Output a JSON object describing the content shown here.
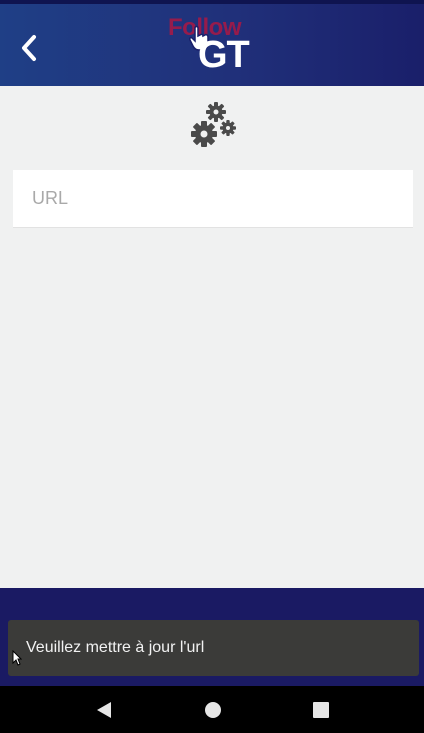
{
  "header": {
    "logo_top_text": "Follow",
    "logo_bottom_text": "GT",
    "icons": {
      "back": "chevron-left-icon",
      "logo_pointer": "hand-pointer-icon"
    }
  },
  "main": {
    "settings_icon": "gears-icon",
    "url_input": {
      "placeholder": "URL",
      "value": ""
    }
  },
  "toast": {
    "message": "Veuillez mettre à jour l'url"
  },
  "system_nav": {
    "icons": [
      "back-triangle-icon",
      "home-circle-icon",
      "recents-square-icon"
    ]
  },
  "colors": {
    "header_gradient_start": "#1f3f86",
    "header_gradient_end": "#1a1f6a",
    "background": "#f0f1f1",
    "bottom_band": "#1a1a63",
    "toast_bg": "#3b3b39",
    "logo_accent": "#be143c"
  }
}
